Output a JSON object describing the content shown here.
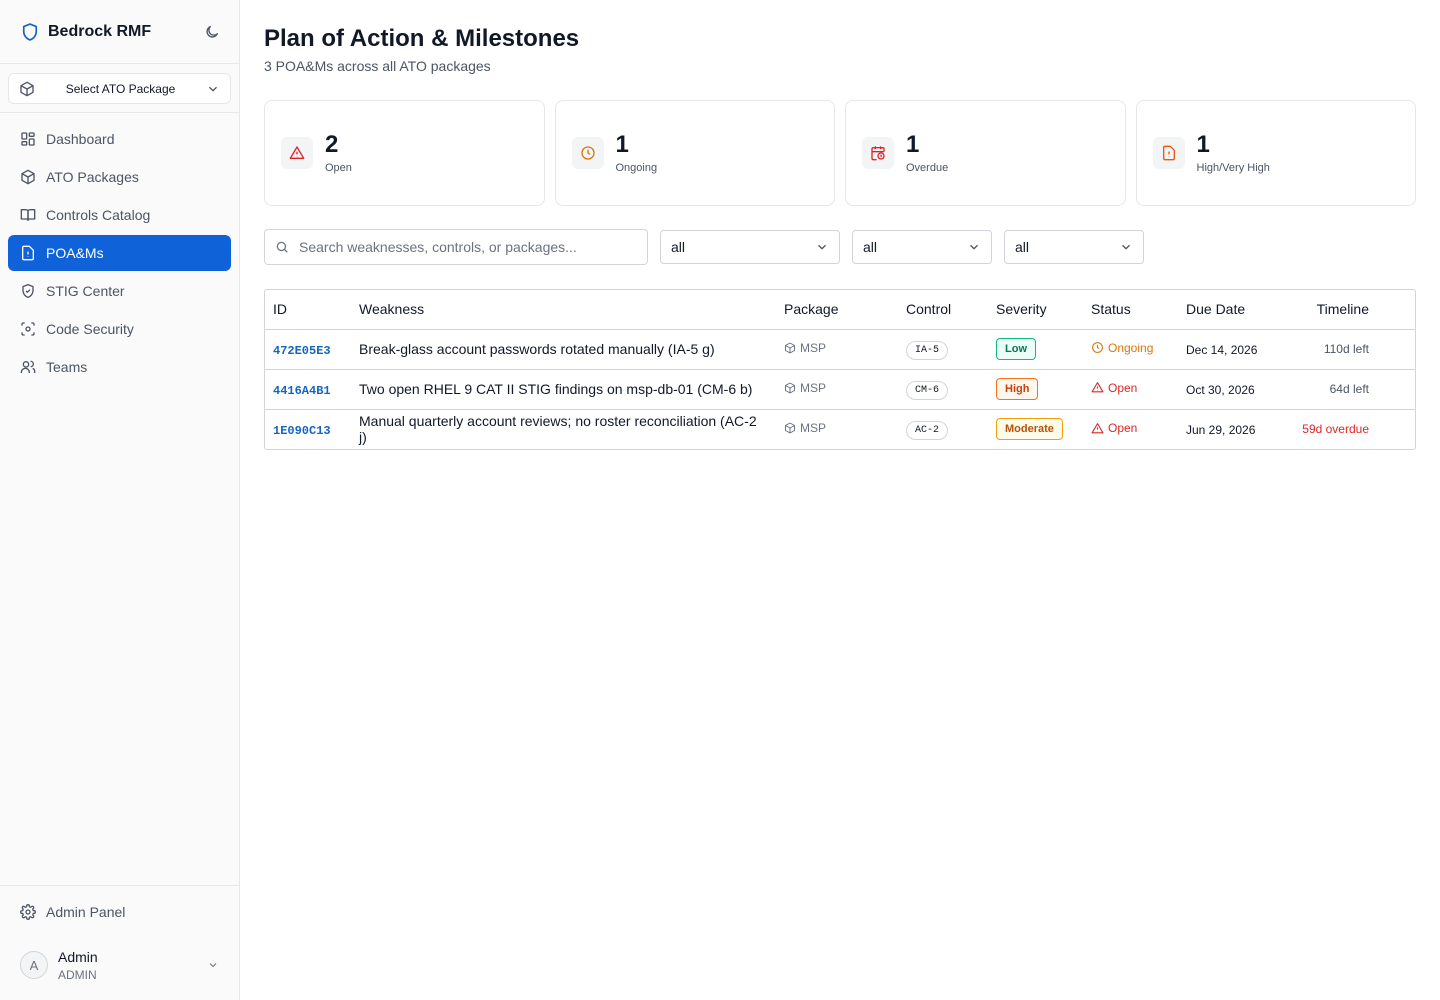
{
  "brand": {
    "name": "Bedrock RMF"
  },
  "package_selector": {
    "label": "Select ATO Package"
  },
  "nav": [
    {
      "label": "Dashboard",
      "icon": "dashboard-icon",
      "active": false
    },
    {
      "label": "ATO Packages",
      "icon": "package-icon",
      "active": false
    },
    {
      "label": "Controls Catalog",
      "icon": "book-icon",
      "active": false
    },
    {
      "label": "POA&Ms",
      "icon": "file-alert-icon",
      "active": true
    },
    {
      "label": "STIG Center",
      "icon": "shield-check-icon",
      "active": false
    },
    {
      "label": "Code Security",
      "icon": "scan-icon",
      "active": false
    },
    {
      "label": "Teams",
      "icon": "users-icon",
      "active": false
    }
  ],
  "admin_panel": {
    "label": "Admin Panel"
  },
  "user": {
    "initial": "A",
    "name": "Admin",
    "role": "ADMIN"
  },
  "page": {
    "title": "Plan of Action & Milestones",
    "subtitle": "3 POA&Ms across all ATO packages"
  },
  "stats": [
    {
      "value": "2",
      "label": "Open",
      "icon": "alert-triangle-icon",
      "color": "#dc2626"
    },
    {
      "value": "1",
      "label": "Ongoing",
      "icon": "clock-icon",
      "color": "#d97706"
    },
    {
      "value": "1",
      "label": "Overdue",
      "icon": "calendar-clock-icon",
      "color": "#dc2626"
    },
    {
      "value": "1",
      "label": "High/Very High",
      "icon": "file-alert-icon",
      "color": "#ea580c"
    }
  ],
  "filters": {
    "search_placeholder": "Search weaknesses, controls, or packages...",
    "selects": [
      "all",
      "all",
      "all"
    ]
  },
  "table": {
    "headers": [
      "ID",
      "Weakness",
      "Package",
      "Control",
      "Severity",
      "Status",
      "Due Date",
      "Timeline"
    ],
    "rows": [
      {
        "id": "472E05E3",
        "weakness": "Break-glass account passwords rotated manually (IA-5 g)",
        "package": "MSP",
        "control": "IA-5",
        "severity": "Low",
        "status": "Ongoing",
        "due": "Dec 14, 2026",
        "timeline": "110d left"
      },
      {
        "id": "4416A4B1",
        "weakness": "Two open RHEL 9 CAT II STIG findings on msp-db-01 (CM-6 b)",
        "package": "MSP",
        "control": "CM-6",
        "severity": "High",
        "status": "Open",
        "due": "Oct 30, 2026",
        "timeline": "64d left"
      },
      {
        "id": "1E090C13",
        "weakness": "Manual quarterly account reviews; no roster reconciliation (AC-2 j)",
        "package": "MSP",
        "control": "AC-2",
        "severity": "Moderate",
        "status": "Open",
        "due": "Jun 29, 2026",
        "timeline": "59d overdue"
      }
    ]
  },
  "colors": {
    "accent": "#0f62d8",
    "id_link": "#1565c0",
    "overdue": "#dc2626",
    "ongoing": "#d97706",
    "open": "#dc2626",
    "severity_low": "#059669",
    "severity_high": "#c2410c",
    "severity_moderate": "#b45309"
  }
}
